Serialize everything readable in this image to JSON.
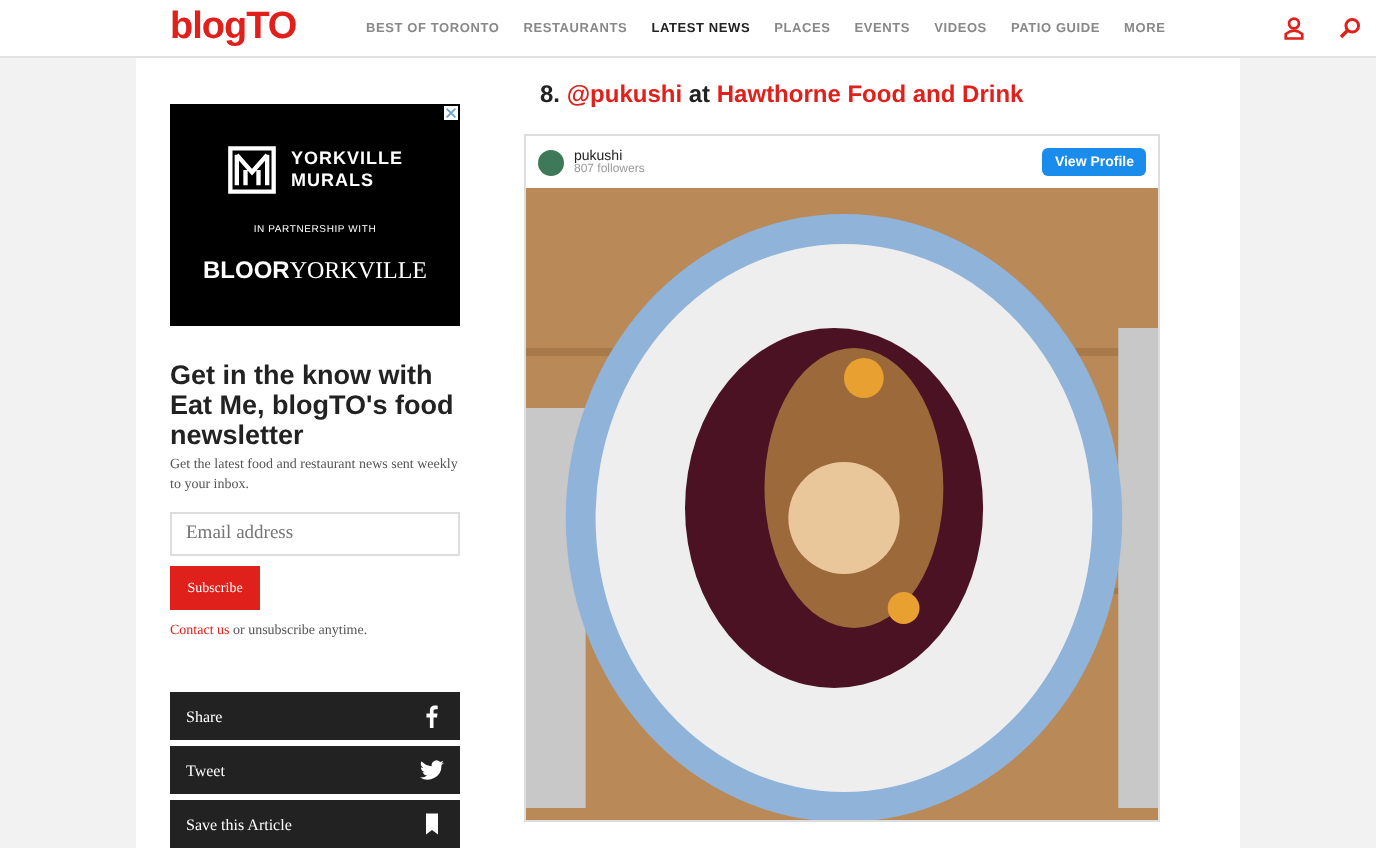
{
  "header": {
    "logo": "blogTO",
    "nav": [
      {
        "label": "BEST OF TORONTO",
        "selected": false
      },
      {
        "label": "RESTAURANTS",
        "selected": false
      },
      {
        "label": "LATEST NEWS",
        "selected": true
      },
      {
        "label": "PLACES",
        "selected": false
      },
      {
        "label": "EVENTS",
        "selected": false
      },
      {
        "label": "VIDEOS",
        "selected": false
      },
      {
        "label": "PATIO GUIDE",
        "selected": false
      },
      {
        "label": "MORE",
        "selected": false
      }
    ]
  },
  "ad": {
    "brand_line_1": "YORKVILLE",
    "brand_line_2": "MURALS",
    "partner_note": "IN PARTNERSHIP WITH",
    "partner_bold": "BLOOR",
    "partner_light": "YORKVILLE"
  },
  "newsletter": {
    "heading": "Get in the know with Eat Me, blogTO's food newsletter",
    "description": "Get the latest food and restaurant news sent weekly to your inbox.",
    "email_placeholder": "Email address",
    "subscribe_button": "Subscribe",
    "contact_link": "Contact us",
    "contact_rest": "or unsubscribe anytime."
  },
  "share_buttons": [
    {
      "label": "Share",
      "kind": "facebook"
    },
    {
      "label": "Tweet",
      "kind": "twitter"
    },
    {
      "label": "Save this Article",
      "kind": "bookmark"
    }
  ],
  "article": {
    "heading": {
      "number": "8.",
      "handle": "@pukushi",
      "connector": "at",
      "venue": "Hawthorne Food and Drink"
    },
    "instagram_post": {
      "username": "pukushi",
      "followers": "807 followers",
      "view_profile_button": "View Profile"
    }
  }
}
